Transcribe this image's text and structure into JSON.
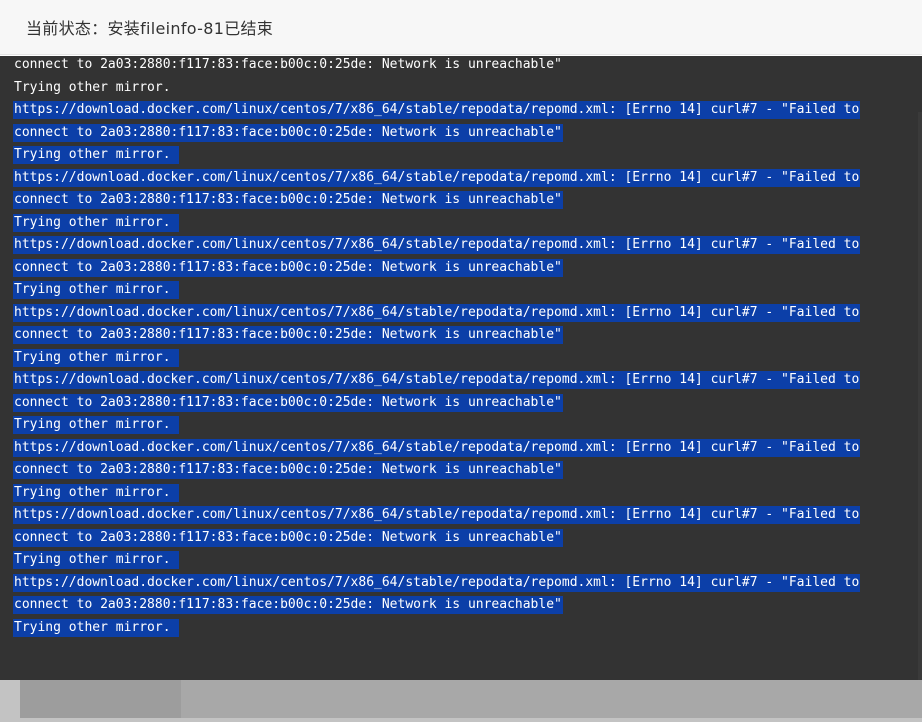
{
  "dialog": {
    "title": "当前状态：安装fileinfo-81已结束"
  },
  "log": {
    "lines": [
      {
        "text": "connect to 2a03:2880:f117:83:face:b00c:0:25de: Network is unreachable\"",
        "selected": false
      },
      {
        "text": "Trying other mirror.",
        "selected": false
      },
      {
        "text": "https://download.docker.com/linux/centos/7/x86_64/stable/repodata/repomd.xml: [Errno 14] curl#7 - \"Failed to",
        "selected": true
      },
      {
        "text": "connect to 2a03:2880:f117:83:face:b00c:0:25de: Network is unreachable\"",
        "selected": true
      },
      {
        "text": "Trying other mirror.",
        "selected": true
      },
      {
        "text": "https://download.docker.com/linux/centos/7/x86_64/stable/repodata/repomd.xml: [Errno 14] curl#7 - \"Failed to",
        "selected": true
      },
      {
        "text": "connect to 2a03:2880:f117:83:face:b00c:0:25de: Network is unreachable\"",
        "selected": true
      },
      {
        "text": "Trying other mirror.",
        "selected": true
      },
      {
        "text": "https://download.docker.com/linux/centos/7/x86_64/stable/repodata/repomd.xml: [Errno 14] curl#7 - \"Failed to",
        "selected": true
      },
      {
        "text": "connect to 2a03:2880:f117:83:face:b00c:0:25de: Network is unreachable\"",
        "selected": true
      },
      {
        "text": "Trying other mirror.",
        "selected": true
      },
      {
        "text": "https://download.docker.com/linux/centos/7/x86_64/stable/repodata/repomd.xml: [Errno 14] curl#7 - \"Failed to",
        "selected": true
      },
      {
        "text": "connect to 2a03:2880:f117:83:face:b00c:0:25de: Network is unreachable\"",
        "selected": true
      },
      {
        "text": "Trying other mirror.",
        "selected": true
      },
      {
        "text": "https://download.docker.com/linux/centos/7/x86_64/stable/repodata/repomd.xml: [Errno 14] curl#7 - \"Failed to",
        "selected": true
      },
      {
        "text": "connect to 2a03:2880:f117:83:face:b00c:0:25de: Network is unreachable\"",
        "selected": true
      },
      {
        "text": "Trying other mirror.",
        "selected": true
      },
      {
        "text": "https://download.docker.com/linux/centos/7/x86_64/stable/repodata/repomd.xml: [Errno 14] curl#7 - \"Failed to",
        "selected": true
      },
      {
        "text": "connect to 2a03:2880:f117:83:face:b00c:0:25de: Network is unreachable\"",
        "selected": true
      },
      {
        "text": "Trying other mirror.",
        "selected": true
      },
      {
        "text": "https://download.docker.com/linux/centos/7/x86_64/stable/repodata/repomd.xml: [Errno 14] curl#7 - \"Failed to",
        "selected": true
      },
      {
        "text": "connect to 2a03:2880:f117:83:face:b00c:0:25de: Network is unreachable\"",
        "selected": true
      },
      {
        "text": "Trying other mirror.",
        "selected": true
      },
      {
        "text": "https://download.docker.com/linux/centos/7/x86_64/stable/repodata/repomd.xml: [Errno 14] curl#7 - \"Failed to",
        "selected": true
      },
      {
        "text": "connect to 2a03:2880:f117:83:face:b00c:0:25de: Network is unreachable\"",
        "selected": true
      },
      {
        "text": "Trying other mirror.",
        "selected": true
      }
    ]
  },
  "colors": {
    "log_background": "#333333",
    "log_text": "#ffffff",
    "selection": "#0c3fa8",
    "header_background": "#f7f7f7"
  }
}
